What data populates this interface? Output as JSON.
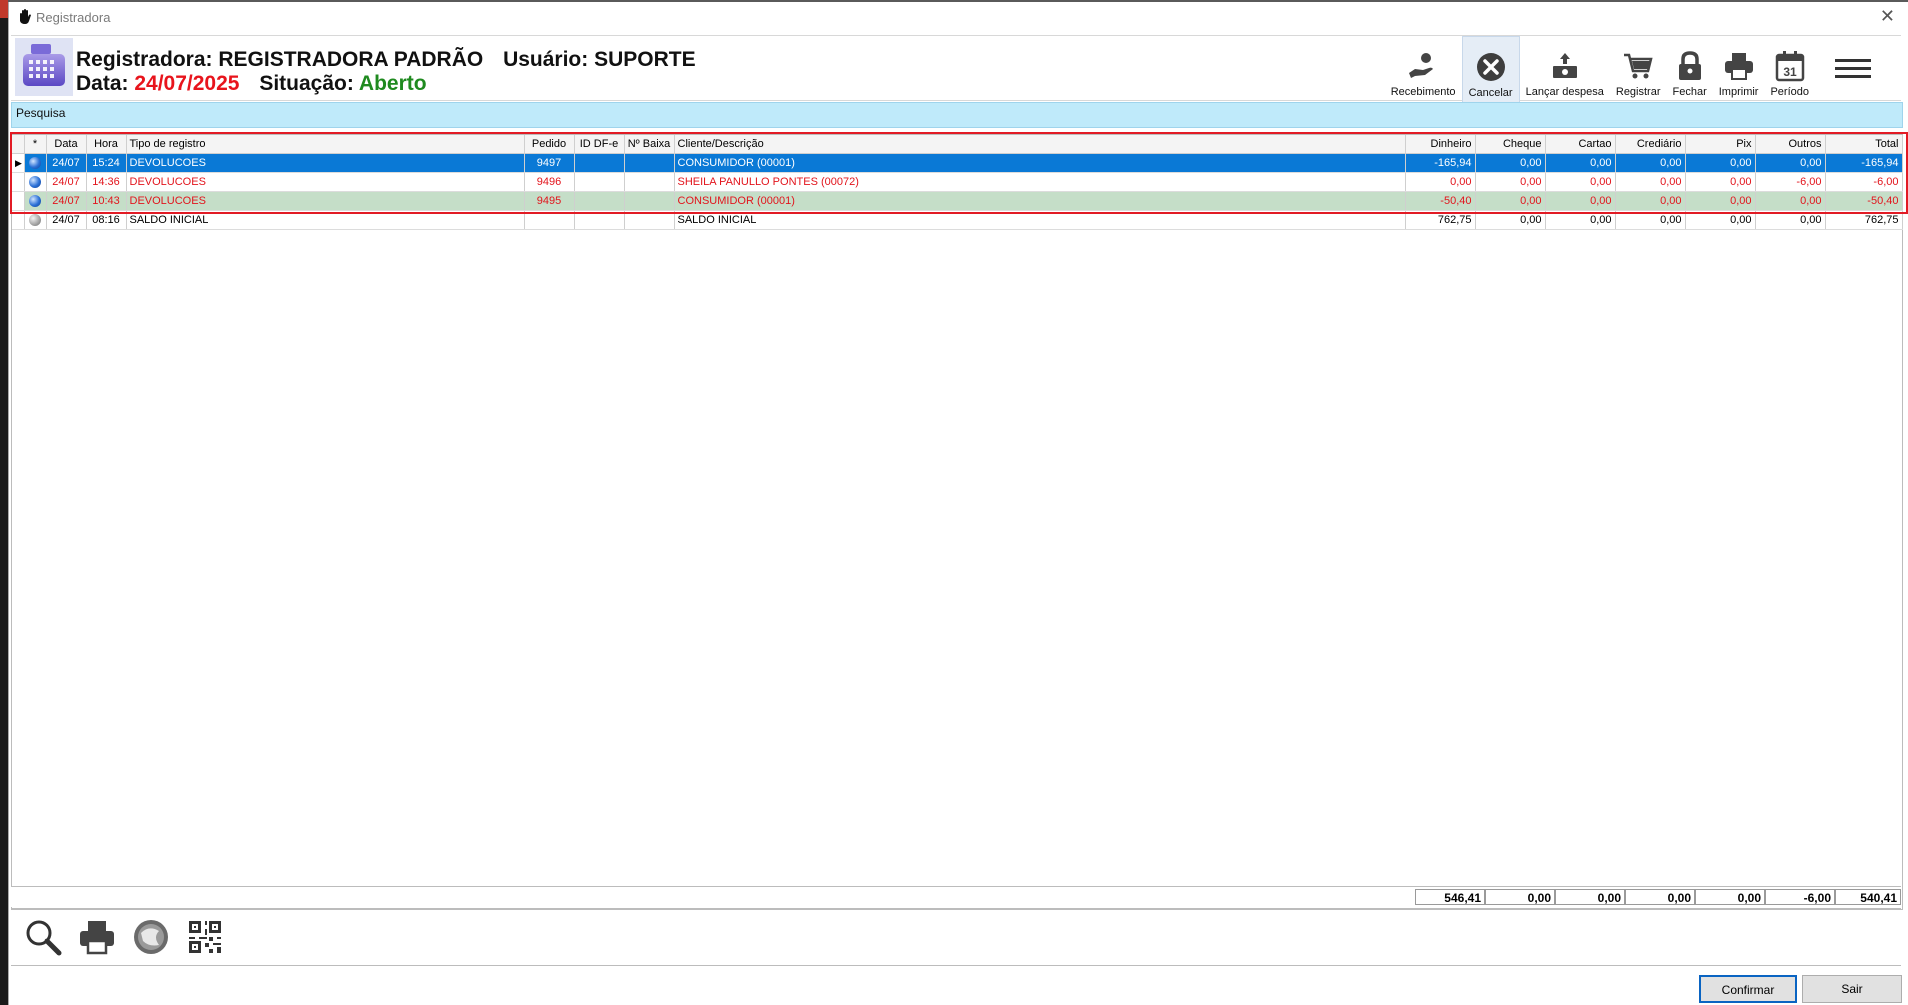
{
  "window": {
    "title": "Registradora"
  },
  "header": {
    "line1_label": "Registradora:",
    "register_name": "REGISTRADORA PADRÃO",
    "user_label": "Usuário:",
    "user_name": "SUPORTE",
    "date_label": "Data:",
    "date_value": "24/07/2025",
    "status_label": "Situação:",
    "status_value": "Aberto"
  },
  "toolbar": {
    "items": [
      {
        "label": "Recebimento",
        "icon": "hand-coin-icon"
      },
      {
        "label": "Cancelar",
        "icon": "cancel-circle-icon",
        "selected": true
      },
      {
        "label": "Lançar despesa",
        "icon": "cash-expense-icon"
      },
      {
        "label": "Registrar",
        "icon": "cart-icon"
      },
      {
        "label": "Fechar",
        "icon": "lock-icon"
      },
      {
        "label": "Imprimir",
        "icon": "printer-icon"
      },
      {
        "label": "Período",
        "icon": "calendar-icon",
        "calendar_day": "31"
      }
    ],
    "menu_icon": "hamburger-menu-icon"
  },
  "search": {
    "label": "Pesquisa"
  },
  "grid": {
    "columns": [
      "*",
      "Data",
      "Hora",
      "Tipo de registro",
      "Pedido",
      "ID DF-e",
      "Nº Baixa",
      "Cliente/Descrição",
      "Dinheiro",
      "Cheque",
      "Cartao",
      "Crediário",
      "Pix",
      "Outros",
      "Total"
    ],
    "rows": [
      {
        "data": "24/07",
        "hora": "15:24",
        "tipo": "DEVOLUCOES",
        "pedido": "9497",
        "iddfe": "",
        "baixa": "",
        "cliente": "CONSUMIDOR (00001)",
        "dinheiro": "-165,94",
        "cheque": "0,00",
        "cartao": "0,00",
        "crediario": "0,00",
        "pix": "0,00",
        "outros": "0,00",
        "total": "-165,94"
      },
      {
        "data": "24/07",
        "hora": "14:36",
        "tipo": "DEVOLUCOES",
        "pedido": "9496",
        "iddfe": "",
        "baixa": "",
        "cliente": "SHEILA PANULLO PONTES (00072)",
        "dinheiro": "0,00",
        "cheque": "0,00",
        "cartao": "0,00",
        "crediario": "0,00",
        "pix": "0,00",
        "outros": "-6,00",
        "total": "-6,00"
      },
      {
        "data": "24/07",
        "hora": "10:43",
        "tipo": "DEVOLUCOES",
        "pedido": "9495",
        "iddfe": "",
        "baixa": "",
        "cliente": "CONSUMIDOR (00001)",
        "dinheiro": "-50,40",
        "cheque": "0,00",
        "cartao": "0,00",
        "crediario": "0,00",
        "pix": "0,00",
        "outros": "0,00",
        "total": "-50,40"
      },
      {
        "data": "24/07",
        "hora": "08:16",
        "tipo": "SALDO INICIAL",
        "pedido": "",
        "iddfe": "",
        "baixa": "",
        "cliente": "SALDO INICIAL",
        "dinheiro": "762,75",
        "cheque": "0,00",
        "cartao": "0,00",
        "crediario": "0,00",
        "pix": "0,00",
        "outros": "0,00",
        "total": "762,75"
      }
    ]
  },
  "totals": {
    "dinheiro": "546,41",
    "cheque": "0,00",
    "cartao": "0,00",
    "crediario": "0,00",
    "pix": "0,00",
    "outros": "-6,00",
    "total": "540,41"
  },
  "bottom_tools": [
    "search-icon",
    "printer-icon",
    "nfe-globe-icon",
    "qr-code-icon"
  ],
  "buttons": {
    "confirm": "Confirmar",
    "exit": "Sair"
  },
  "colors": {
    "accent_blue": "#0a79d6",
    "status_red": "#e2141c",
    "status_green": "#1f8a1f",
    "row_green": "#c5dec8",
    "search_bg": "#bfeafa",
    "frame_red": "#e21b25"
  }
}
